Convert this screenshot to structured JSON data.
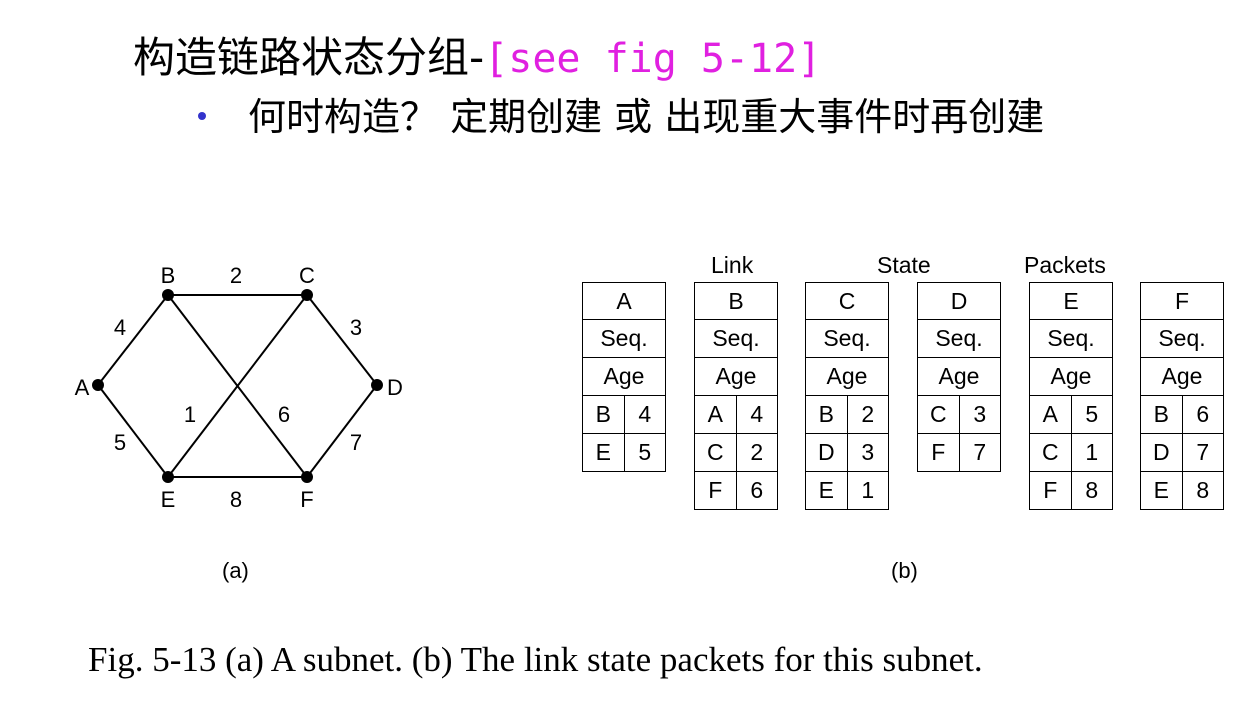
{
  "title": {
    "main": "构造链路状态分组-",
    "ref": "[see fig 5-12]"
  },
  "bullet": {
    "text": "何时构造？ 定期创建 或 出现重大事件时再创建"
  },
  "subnet": {
    "nodes": [
      {
        "id": "A",
        "label": "A"
      },
      {
        "id": "B",
        "label": "B"
      },
      {
        "id": "C",
        "label": "C"
      },
      {
        "id": "D",
        "label": "D"
      },
      {
        "id": "E",
        "label": "E"
      },
      {
        "id": "F",
        "label": "F"
      }
    ],
    "edges": [
      {
        "from": "A",
        "to": "B",
        "weight": "4"
      },
      {
        "from": "B",
        "to": "C",
        "weight": "2"
      },
      {
        "from": "C",
        "to": "D",
        "weight": "3"
      },
      {
        "from": "A",
        "to": "E",
        "weight": "5"
      },
      {
        "from": "E",
        "to": "F",
        "weight": "8"
      },
      {
        "from": "D",
        "to": "F",
        "weight": "7"
      },
      {
        "from": "E",
        "to": "C",
        "weight": "1"
      },
      {
        "from": "B",
        "to": "F",
        "weight": "6"
      }
    ],
    "label": "(a)"
  },
  "packets": {
    "header_words": [
      "Link",
      "State",
      "Packets"
    ],
    "seq_label": "Seq.",
    "age_label": "Age",
    "items": [
      {
        "node": "A",
        "links": [
          [
            "B",
            "4"
          ],
          [
            "E",
            "5"
          ]
        ]
      },
      {
        "node": "B",
        "links": [
          [
            "A",
            "4"
          ],
          [
            "C",
            "2"
          ],
          [
            "F",
            "6"
          ]
        ]
      },
      {
        "node": "C",
        "links": [
          [
            "B",
            "2"
          ],
          [
            "D",
            "3"
          ],
          [
            "E",
            "1"
          ]
        ]
      },
      {
        "node": "D",
        "links": [
          [
            "C",
            "3"
          ],
          [
            "F",
            "7"
          ]
        ]
      },
      {
        "node": "E",
        "links": [
          [
            "A",
            "5"
          ],
          [
            "C",
            "1"
          ],
          [
            "F",
            "8"
          ]
        ]
      },
      {
        "node": "F",
        "links": [
          [
            "B",
            "6"
          ],
          [
            "D",
            "7"
          ],
          [
            "E",
            "8"
          ]
        ]
      }
    ],
    "label": "(b)"
  },
  "caption": "Fig. 5-13 (a) A subnet.  (b) The link state packets for this subnet."
}
